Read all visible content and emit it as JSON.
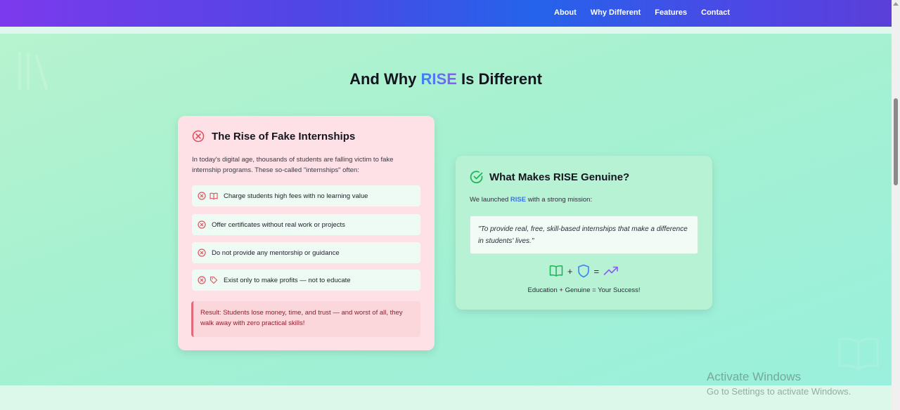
{
  "nav": {
    "links": [
      "About",
      "Why Different",
      "Features",
      "Contact"
    ]
  },
  "heading": {
    "prefix": "And Why ",
    "highlight": "RISE",
    "suffix": " Is Different"
  },
  "fake_card": {
    "title": "The Rise of Fake Internships",
    "description": "In today's digital age, thousands of students are falling victim to fake internship programs. These so-called \"internships\" often:",
    "issues": [
      {
        "text": "Charge students high fees with no learning value",
        "extra_icon": "book-icon"
      },
      {
        "text": "Offer certificates without real work or projects",
        "extra_icon": ""
      },
      {
        "text": "Do not provide any mentorship or guidance",
        "extra_icon": ""
      },
      {
        "text": "Exist only to make profits — not to educate",
        "extra_icon": "tag-icon"
      }
    ],
    "result": "Result: Students lose money, time, and trust — and worst of all, they walk away with zero practical skills!"
  },
  "genuine_card": {
    "title": "What Makes RISE Genuine?",
    "intro_prefix": "We launched ",
    "intro_highlight": "RISE",
    "intro_suffix": " with a strong mission:",
    "quote": "\"To provide real, free, skill-based internships that make a difference in students' lives.\"",
    "equation": {
      "plus": "+",
      "equals": "="
    },
    "caption": "Education + Genuine = Your Success!"
  },
  "watermark": {
    "title": "Activate Windows",
    "subtitle": "Go to Settings to activate Windows."
  },
  "colors": {
    "accent_gradient_start": "#3b82f6",
    "accent_gradient_end": "#8b5cf6",
    "fake_card_bg": "#fde1e6",
    "genuine_card_bg": "#b7f2d5",
    "error_red": "#e0525f",
    "success_green": "#22b45a"
  }
}
